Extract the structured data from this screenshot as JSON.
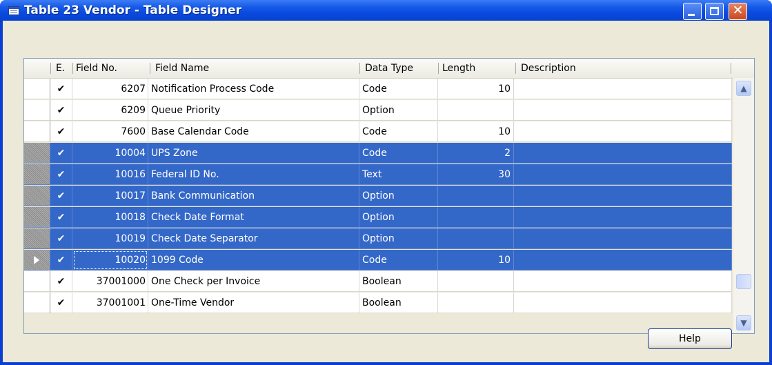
{
  "window": {
    "title": "Table 23 Vendor - Table Designer",
    "close_glyph": "✕"
  },
  "table": {
    "headers": {
      "enabled": "E.",
      "field_no": "Field No.",
      "field_name": "Field Name",
      "data_type": "Data Type",
      "length": "Length",
      "description": "Description"
    },
    "rows": [
      {
        "enabled": "✔",
        "field_no": "6207",
        "field_name": "Notification Process Code",
        "data_type": "Code",
        "length": "10",
        "description": "",
        "selected": false
      },
      {
        "enabled": "✔",
        "field_no": "6209",
        "field_name": "Queue Priority",
        "data_type": "Option",
        "length": "",
        "description": "",
        "selected": false
      },
      {
        "enabled": "✔",
        "field_no": "7600",
        "field_name": "Base Calendar Code",
        "data_type": "Code",
        "length": "10",
        "description": "",
        "selected": false
      },
      {
        "enabled": "✔",
        "field_no": "10004",
        "field_name": "UPS Zone",
        "data_type": "Code",
        "length": "2",
        "description": "",
        "selected": true
      },
      {
        "enabled": "✔",
        "field_no": "10016",
        "field_name": "Federal ID No.",
        "data_type": "Text",
        "length": "30",
        "description": "",
        "selected": true
      },
      {
        "enabled": "✔",
        "field_no": "10017",
        "field_name": "Bank Communication",
        "data_type": "Option",
        "length": "",
        "description": "",
        "selected": true
      },
      {
        "enabled": "✔",
        "field_no": "10018",
        "field_name": "Check Date Format",
        "data_type": "Option",
        "length": "",
        "description": "",
        "selected": true
      },
      {
        "enabled": "✔",
        "field_no": "10019",
        "field_name": "Check Date Separator",
        "data_type": "Option",
        "length": "",
        "description": "",
        "selected": true
      },
      {
        "enabled": "✔",
        "field_no": "10020",
        "field_name": "1099 Code",
        "data_type": "Code",
        "length": "10",
        "description": "",
        "selected": true,
        "current": true
      },
      {
        "enabled": "✔",
        "field_no": "37001000",
        "field_name": "One Check per Invoice",
        "data_type": "Boolean",
        "length": "",
        "description": "",
        "selected": false
      },
      {
        "enabled": "✔",
        "field_no": "37001001",
        "field_name": "One-Time Vendor",
        "data_type": "Boolean",
        "length": "",
        "description": "",
        "selected": false
      }
    ]
  },
  "scrollbar": {
    "up_glyph": "▲",
    "down_glyph": "▼"
  },
  "buttons": {
    "help_label": "Help"
  }
}
